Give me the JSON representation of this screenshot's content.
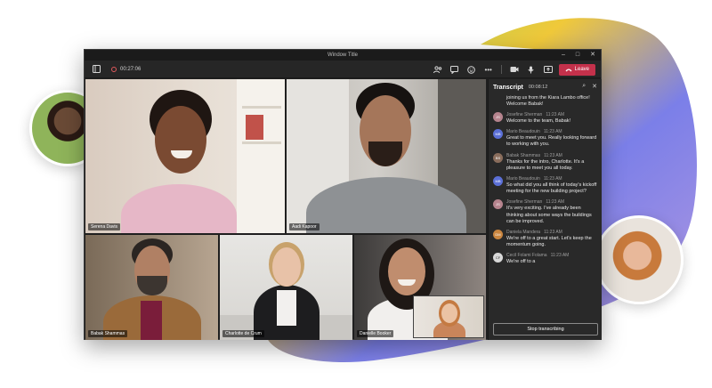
{
  "window": {
    "title": "Window Title"
  },
  "toolbar": {
    "timer": "00:27:06",
    "leave_label": "Leave"
  },
  "participants": [
    {
      "name": "Serena Davis"
    },
    {
      "name": "Aadi Kapoor"
    },
    {
      "name": "Babak Shammas"
    },
    {
      "name": "Charlotte de Crum"
    },
    {
      "name": "Danielle Booker"
    }
  ],
  "transcript": {
    "title": "Transcript",
    "time": "00:08:12",
    "partial_line": "joining us from the Kiara Lambo office! Welcome Babak!",
    "entries": [
      {
        "initials": "JS",
        "color": "#b5838d",
        "speaker": "Josefine Sherman",
        "time": "11:23 AM",
        "text": "Welcome to the team, Babak!"
      },
      {
        "initials": "MB",
        "color": "#5b6fd6",
        "speaker": "Mario Beaudouin",
        "time": "11:23 AM",
        "text": "Great to meet you. Really looking forward to working with you."
      },
      {
        "initials": "BS",
        "color": "#8a6d5c",
        "speaker": "Babak Shammas",
        "time": "11:23 AM",
        "text": "Thanks for the intro, Charlotte. It's a pleasure to meet you all today."
      },
      {
        "initials": "MB",
        "color": "#5b6fd6",
        "speaker": "Mario Beaudouin",
        "time": "11:23 AM",
        "text": "So what did you all think of today's kickoff meeting for the new building project?"
      },
      {
        "initials": "JS",
        "color": "#b5838d",
        "speaker": "Josefine Sherman",
        "time": "11:23 AM",
        "text": "It's very exciting. I've already been thinking about some ways the buildings can be improved."
      },
      {
        "initials": "DM",
        "color": "#c9853f",
        "speaker": "Daniela Mandera",
        "time": "11:23 AM",
        "text": "We're off to a great start. Let's keep the momentum going."
      },
      {
        "initials": "CF",
        "color": "#d8d8d8",
        "speaker": "Cecil Folami Folama",
        "time": "11:23 AM",
        "text": "We're off to a"
      }
    ],
    "stop_label": "Stop transcribing"
  },
  "colors": {
    "leave": "#c4314b",
    "window_bg": "#1f1f1f",
    "panel_bg": "#292929"
  },
  "icons": [
    "sidebar-icon",
    "record-icon",
    "people-icon",
    "chat-icon",
    "reactions-icon",
    "more-icon",
    "camera-icon",
    "mic-icon",
    "share-icon",
    "phone-icon",
    "search-icon",
    "close-icon"
  ]
}
